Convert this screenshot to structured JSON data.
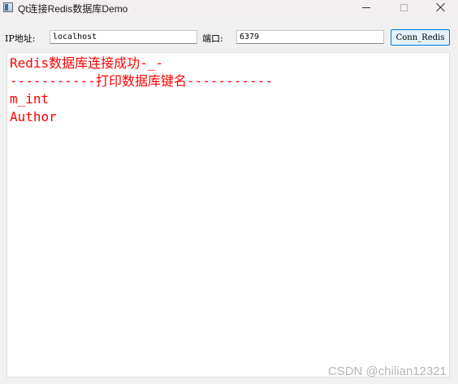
{
  "window": {
    "title": "Qt连接Redis数据库Demo"
  },
  "toolbar": {
    "ip_label": "IP地址:",
    "ip_value": "localhost",
    "port_label": "端口:",
    "port_value": "6379",
    "connect_button": "Conn_Redis"
  },
  "output": {
    "lines": [
      "Redis数据库连接成功-_-",
      "-----------打印数据库键名-----------",
      "m_int",
      "Author"
    ],
    "text_color": "#ff0000"
  },
  "watermark": "CSDN @chilian12321"
}
